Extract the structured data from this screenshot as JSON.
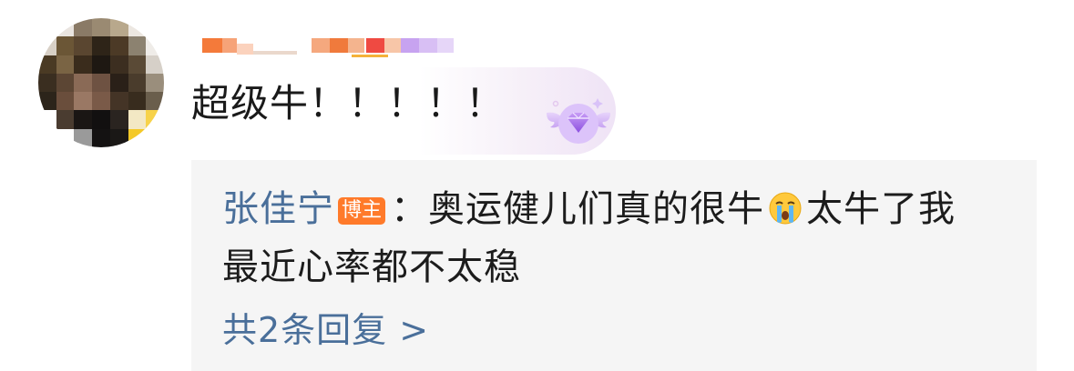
{
  "comment": {
    "text": "超级牛！！！！！",
    "avatar_icon": "pixelated-avatar",
    "username_icon": "pixelated-username",
    "badge_icon": "purple-diamond-badge-icon"
  },
  "reply": {
    "author": "张佳宁",
    "author_tag": "博主",
    "separator": "：",
    "text_part1": "奥运健儿们真的很牛",
    "emoji_icon": "crying-face-icon",
    "text_part2": "太牛了我",
    "text_line2": "最近心率都不太稳"
  },
  "more_replies": {
    "label": "共2条回复 >"
  },
  "colors": {
    "link_blue": "#4a6f9a",
    "tag_orange": "#ff7a2a",
    "reply_bg": "#f5f5f5",
    "text": "#1c1c1c"
  }
}
